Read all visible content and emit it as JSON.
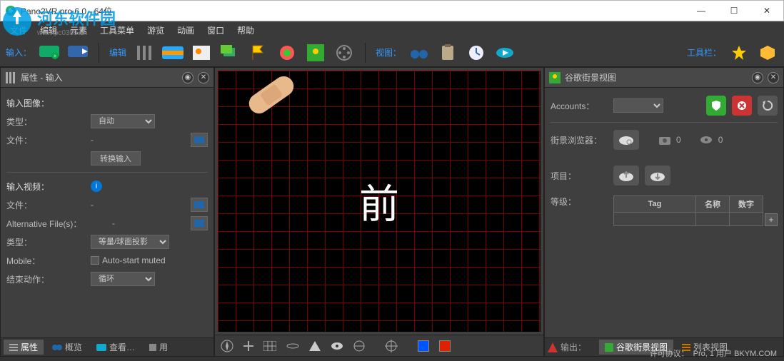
{
  "window": {
    "title": "Pano2VR pro 6.0 - 64位",
    "min": "—",
    "max": "☐",
    "close": "✕"
  },
  "watermark": {
    "line1": "河东软件园",
    "line2": "www.pc0359.cn"
  },
  "menu": [
    "文件",
    "编辑",
    "元素",
    "工具菜单",
    "游览",
    "动画",
    "窗口",
    "帮助"
  ],
  "toolbar": {
    "group_input": "输入：",
    "group_edit": "编辑",
    "group_view": "视图：",
    "group_tools": "工具栏："
  },
  "left_panel": {
    "title": "属性 - 输入",
    "sec_input": "输入图像：",
    "type_lbl": "类型：",
    "type_val": "自动",
    "file_lbl": "文件：",
    "file_val": "-",
    "convert_btn": "转换输入",
    "sec_video": "输入视频：",
    "vfile_lbl": "文件：",
    "vfile_val": "-",
    "altfile_lbl": "Alternative File(s)：",
    "altfile_val": "-",
    "vtype_lbl": "类型：",
    "vtype_val": "等量/球面投影",
    "mobile_lbl": "Mobile：",
    "mobile_chk": "Auto-start muted",
    "endaction_lbl": "结束动作：",
    "endaction_val": "循环",
    "tabs": [
      "属性",
      "概览",
      "查看…",
      "用"
    ]
  },
  "viewport": {
    "char": "前"
  },
  "right_panel": {
    "title": "谷歌街景视图",
    "accounts_lbl": "Accounts：",
    "browser_lbl": "街景浏览器：",
    "cam_count": "0",
    "eye_count": "0",
    "project_lbl": "项目：",
    "level_lbl": "等级：",
    "th_tag": "Tag",
    "th_name": "名称",
    "th_num": "数字",
    "tabs_out_lbl": "输出：",
    "tabs": [
      "谷歌街景视图",
      "列表视图"
    ]
  },
  "status": {
    "license_lbl": "许可协议：",
    "license_val": "Pro, 1 用户 BKYM.COM"
  }
}
